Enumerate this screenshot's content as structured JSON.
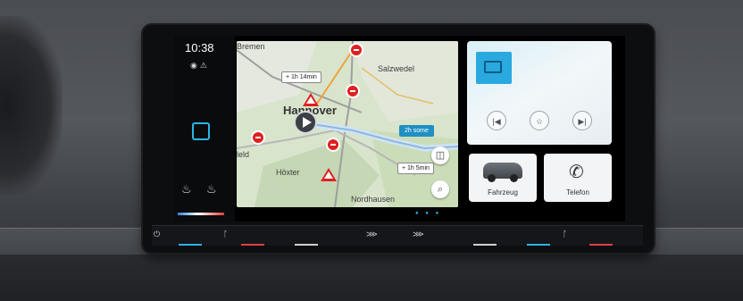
{
  "status": {
    "time": "10:38"
  },
  "map": {
    "cities": [
      "Bremen",
      "Salzwedel",
      "Hannover",
      "leld",
      "Höxter",
      "Nordhausen"
    ],
    "delay_1": "+ 1h 14min",
    "delay_2": "+ 1h 5min",
    "route_info": "2h some"
  },
  "tiles": {
    "vehicle_label": "Fahrzeug",
    "phone_label": "Telefon"
  },
  "colors": {
    "accent": "#29b6e6",
    "incident": "#e02020",
    "route": "#cfe4f5"
  },
  "icons": [
    "globe-icon",
    "signal-icon",
    "app-icon",
    "seat-heat-driver-icon",
    "seat-heat-passenger-icon",
    "radio-icon",
    "prev-track-icon",
    "favorite-icon",
    "next-track-icon",
    "car-icon",
    "phone-icon",
    "search-icon",
    "camera-icon",
    "power-icon"
  ]
}
